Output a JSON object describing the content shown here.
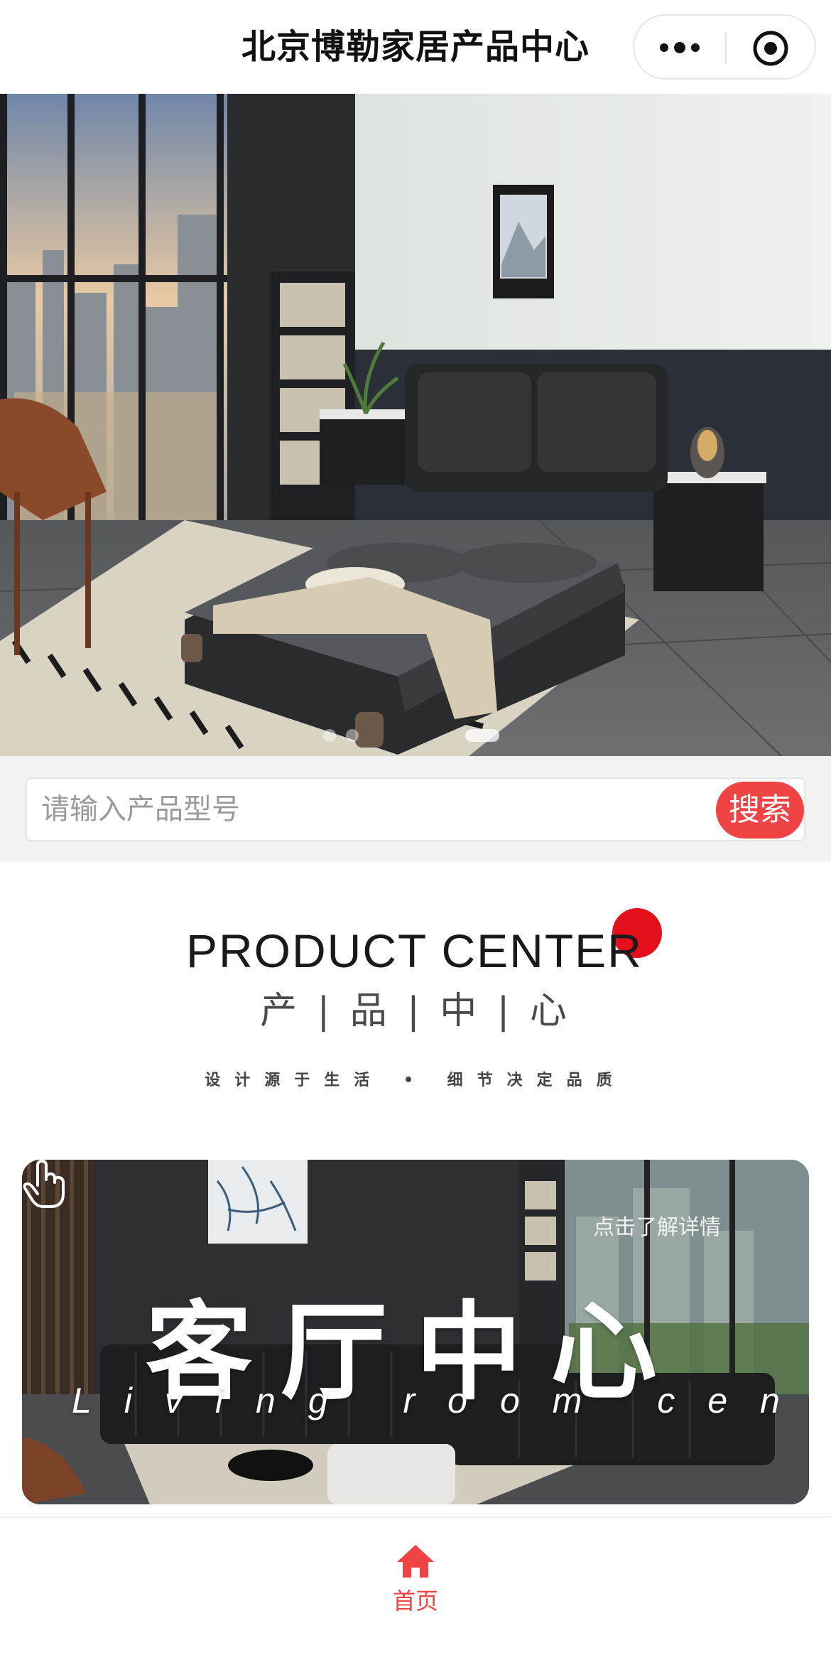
{
  "navbar": {
    "title": "北京博勒家居产品中心"
  },
  "search": {
    "placeholder": "请输入产品型号",
    "value": "",
    "button_label": "搜索"
  },
  "product_center": {
    "title_en": "PRODUCT CENTER",
    "title_cn": "产 | 品 | 中 | 心",
    "slogan": "设计源于生活 • 细节决定品质"
  },
  "category_card": {
    "hint": "点击了解详情",
    "title": "客厅中心",
    "subtitle": "Living room center"
  },
  "tabbar": {
    "home_label": "首页"
  },
  "colors": {
    "accent": "#f04343",
    "logo_dot": "#e3101b"
  },
  "icons": [
    "more-icon",
    "close-icon",
    "hand-pointer-icon",
    "home-icon"
  ]
}
